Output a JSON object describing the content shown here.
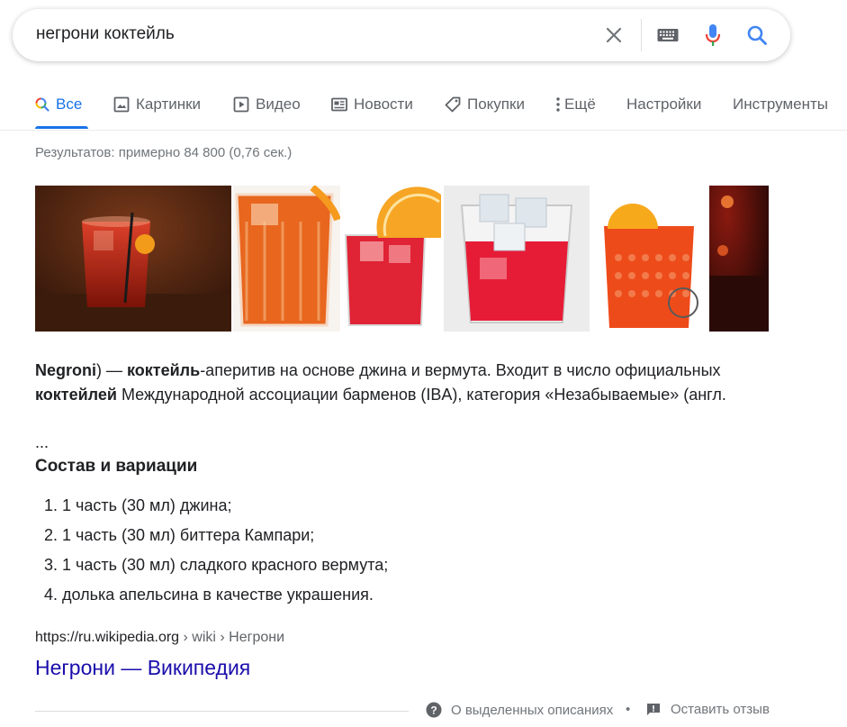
{
  "search": {
    "query": "негрони коктейль"
  },
  "icons": {
    "clear": "close-icon",
    "keyboard": "keyboard-icon",
    "mic": "microphone-icon",
    "search": "search-icon"
  },
  "colors": {
    "accent": "#1a73e8",
    "link": "#1a0dab",
    "text": "#202124",
    "muted": "#70757a"
  },
  "tabs": [
    {
      "label": "Все",
      "icon": "search-icon",
      "active": true
    },
    {
      "label": "Картинки",
      "icon": "image-icon"
    },
    {
      "label": "Видео",
      "icon": "video-icon"
    },
    {
      "label": "Новости",
      "icon": "news-icon"
    },
    {
      "label": "Покупки",
      "icon": "tag-icon"
    },
    {
      "label": "Ещё",
      "icon": "more-vert-icon"
    },
    {
      "label": "Настройки"
    },
    {
      "label": "Инструменты"
    }
  ],
  "stats": "Результатов: примерно 84 800 (0,76 сек.)",
  "snippet": {
    "parts": [
      {
        "text": "Negroni",
        "bold": true
      },
      {
        "text": ") — "
      },
      {
        "text": "коктейль",
        "bold": true
      },
      {
        "text": "-аперитив на основе джина и вермута. Входит в число официальных "
      },
      {
        "text": "коктейлей",
        "bold": true
      },
      {
        "text": " Международной ассоциации барменов (IBA), категория «Незабываемые» (англ."
      }
    ],
    "ellipsis": "...",
    "section_heading": "Состав и вариации",
    "ingredients": [
      "1 часть (30 мл) джина;",
      "1 часть (30 мл) биттера Кампари;",
      "1 часть (30 мл) сладкого красного вермута;",
      "долька апельсина в качестве украшения."
    ]
  },
  "result": {
    "url_domain": "https://ru.wikipedia.org",
    "url_path": " › wiki › Негрони",
    "title": "Негрони — Википедия"
  },
  "footer": {
    "about": "О выделенных описаниях",
    "separator": "•",
    "feedback": "Оставить отзыв"
  }
}
